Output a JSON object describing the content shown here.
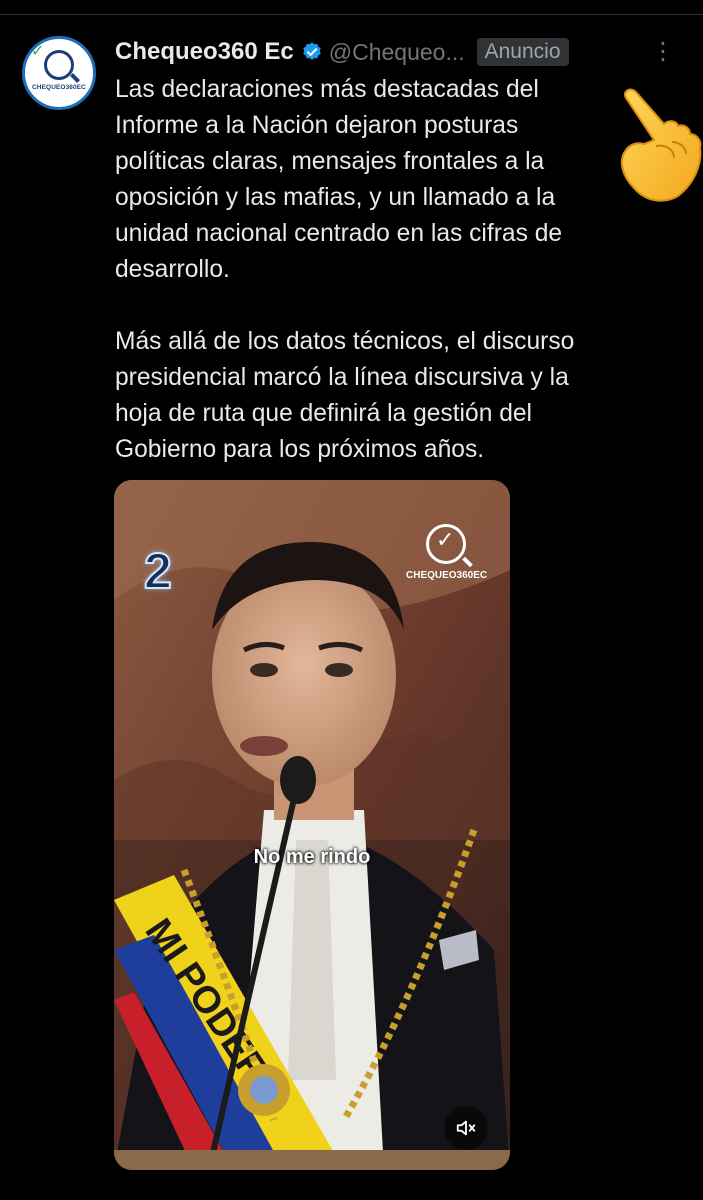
{
  "post": {
    "author_name": "Chequeo360 Ec",
    "handle": "@Chequeo...",
    "ad_label": "Anuncio",
    "more_label": "⋮",
    "avatar_text": "CHEQUEO360EC",
    "text": "Las declaraciones más destacadas del\nInforme a la Nación dejaron posturas\npolíticas claras, mensajes frontales a la\noposición y las mafias, y un llamado a la\nunidad nacional centrado en las cifras de\ndesarrollo.\n\nMás allá de los datos técnicos, el discurso\npresidencial marcó la línea discursiva y la\nhoja de ruta que definirá la gestión del\nGobierno para los próximos años."
  },
  "video": {
    "badge_number": "2",
    "watermark": "CHEQUEO360EC",
    "caption": "No me rindo",
    "sash_text": "MI PODER"
  },
  "icons": {
    "verified": "verified-badge-icon",
    "more": "more-options-icon",
    "mute": "muted-speaker-icon",
    "emoji": "backhand-index-pointing-right-emoji"
  },
  "colors": {
    "background": "#000000",
    "text": "#e7e9ea",
    "muted": "#71767b",
    "verified": "#1d9bf0"
  }
}
